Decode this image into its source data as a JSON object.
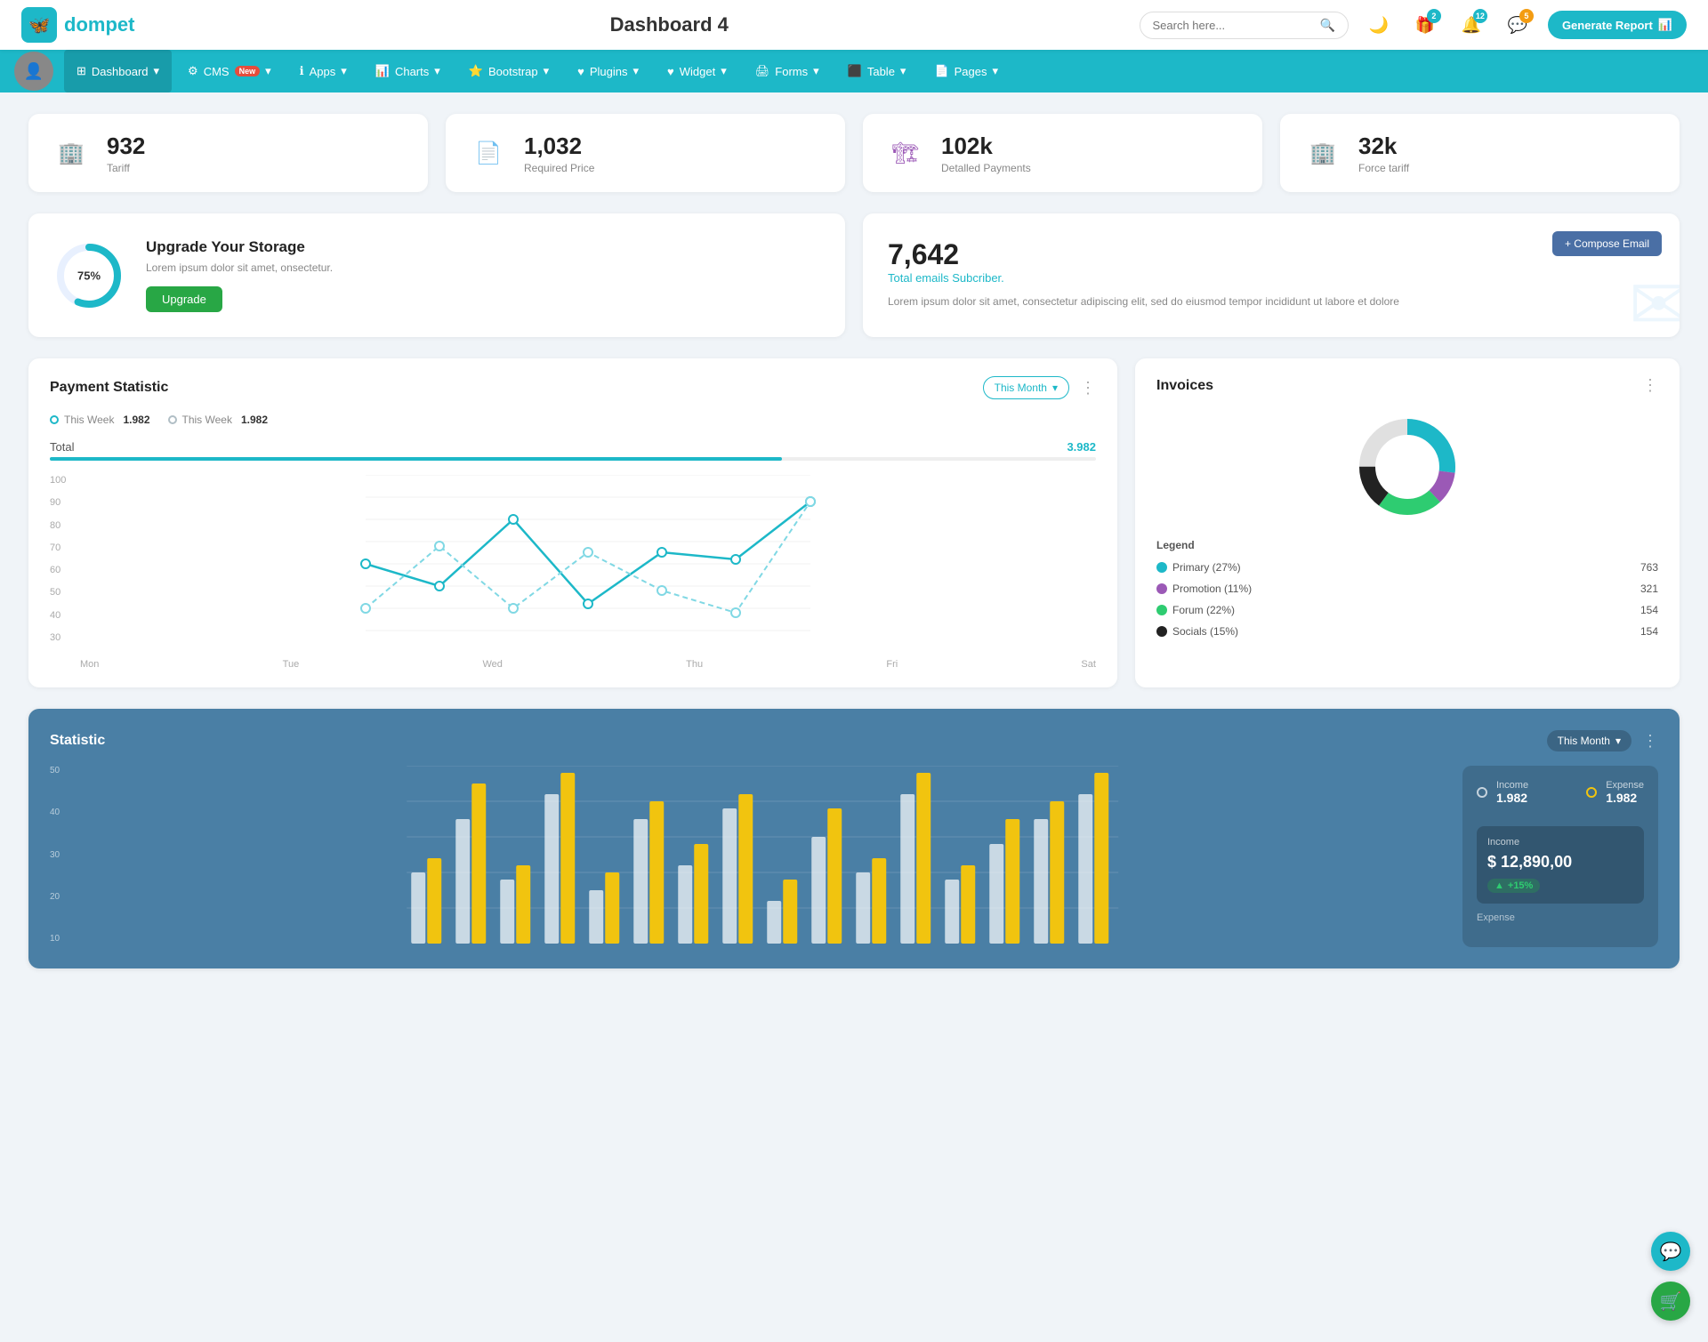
{
  "header": {
    "logo_text": "dompet",
    "page_title": "Dashboard 4",
    "search_placeholder": "Search here...",
    "icons": {
      "moon": "🌙",
      "gift": "🎁",
      "bell": "🔔",
      "chat": "💬"
    },
    "badges": {
      "gift": "2",
      "bell": "12",
      "chat": "5"
    },
    "generate_btn": "Generate Report"
  },
  "nav": {
    "items": [
      {
        "label": "Dashboard",
        "icon": "⊞",
        "has_dropdown": true,
        "active": true
      },
      {
        "label": "CMS",
        "icon": "⚙",
        "has_dropdown": true,
        "is_new": true
      },
      {
        "label": "Apps",
        "icon": "ℹ",
        "has_dropdown": true
      },
      {
        "label": "Charts",
        "icon": "📊",
        "has_dropdown": true
      },
      {
        "label": "Bootstrap",
        "icon": "⭐",
        "has_dropdown": true
      },
      {
        "label": "Plugins",
        "icon": "♥",
        "has_dropdown": true
      },
      {
        "label": "Widget",
        "icon": "♥",
        "has_dropdown": true
      },
      {
        "label": "Forms",
        "icon": "🖨",
        "has_dropdown": true
      },
      {
        "label": "Table",
        "icon": "⬛",
        "has_dropdown": true
      },
      {
        "label": "Pages",
        "icon": "📄",
        "has_dropdown": true
      }
    ]
  },
  "stat_cards": [
    {
      "number": "932",
      "label": "Tariff",
      "icon": "🏢",
      "icon_color": "#1db8c8"
    },
    {
      "number": "1,032",
      "label": "Required Price",
      "icon": "📄",
      "icon_color": "#e74c3c"
    },
    {
      "number": "102k",
      "label": "Detalled Payments",
      "icon": "🏗",
      "icon_color": "#9b59b6"
    },
    {
      "number": "32k",
      "label": "Force tariff",
      "icon": "🏢",
      "icon_color": "#e91e8c"
    }
  ],
  "storage": {
    "progress": 75,
    "progress_label": "75%",
    "title": "Upgrade Your Storage",
    "description": "Lorem ipsum dolor sit amet, onsectetur.",
    "button_label": "Upgrade"
  },
  "email": {
    "count": "7,642",
    "subtitle": "Total emails Subcriber.",
    "description": "Lorem ipsum dolor sit amet, consectetur adipiscing elit, sed do eiusmod tempor incididunt ut labore et dolore",
    "compose_btn": "+ Compose Email"
  },
  "payment_chart": {
    "title": "Payment Statistic",
    "filter_label": "This Month",
    "legend": [
      {
        "label": "This Week",
        "value": "1.982",
        "color": "#1db8c8"
      },
      {
        "label": "This Week",
        "value": "1.982",
        "color": "#b0bec5"
      }
    ],
    "total_label": "Total",
    "total_value": "3.982",
    "progress_percent": 70,
    "x_labels": [
      "Mon",
      "Tue",
      "Wed",
      "Thu",
      "Fri",
      "Sat"
    ],
    "y_labels": [
      "100",
      "90",
      "80",
      "70",
      "60",
      "50",
      "40",
      "30"
    ],
    "series1": [
      60,
      50,
      80,
      42,
      65,
      62,
      88
    ],
    "series2": [
      40,
      68,
      40,
      65,
      48,
      38,
      88
    ]
  },
  "invoices": {
    "title": "Invoices",
    "legend": [
      {
        "label": "Primary (27%)",
        "value": "763",
        "color": "#1db8c8"
      },
      {
        "label": "Promotion (11%)",
        "value": "321",
        "color": "#9b59b6"
      },
      {
        "label": "Forum (22%)",
        "value": "154",
        "color": "#2ecc71"
      },
      {
        "label": "Socials (15%)",
        "value": "154",
        "color": "#222"
      }
    ],
    "legend_title": "Legend",
    "donut": {
      "segments": [
        {
          "percent": 27,
          "color": "#1db8c8"
        },
        {
          "percent": 11,
          "color": "#9b59b6"
        },
        {
          "percent": 22,
          "color": "#2ecc71"
        },
        {
          "percent": 15,
          "color": "#222"
        },
        {
          "percent": 25,
          "color": "#e0e0e0"
        }
      ]
    }
  },
  "statistic": {
    "title": "Statistic",
    "filter_label": "This Month",
    "y_labels": [
      "50",
      "40",
      "30",
      "20",
      "10"
    ],
    "income": {
      "label": "Income",
      "value": "1.982",
      "amount": "$ 12,890,00",
      "change": "+15%"
    },
    "expense": {
      "label": "Expense",
      "value": "1.982"
    },
    "bar_data": {
      "white_bars": [
        20,
        35,
        18,
        42,
        15,
        35,
        22,
        38,
        12,
        30,
        20,
        42,
        18,
        28,
        35,
        22
      ],
      "yellow_bars": [
        28,
        45,
        22,
        48,
        20,
        40,
        28,
        42,
        18,
        38,
        26,
        48,
        22,
        35,
        40,
        28
      ]
    }
  }
}
